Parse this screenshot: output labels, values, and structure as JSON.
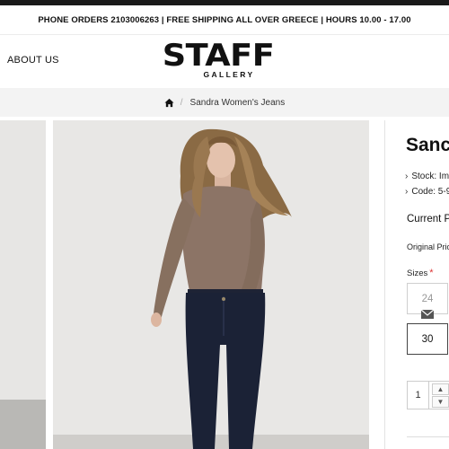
{
  "announcement": "PHONE ORDERS 2103006263 | FREE SHIPPING ALL OVER GREECE | HOURS 10.00 - 17.00",
  "header": {
    "about": "ABOUT US",
    "logo_main": "STAFF",
    "logo_sub": "GALLERY"
  },
  "breadcrumb": {
    "separator": "/",
    "current": "Sandra Women's Jeans"
  },
  "product": {
    "title": "Sanc",
    "stock": "Stock: Im",
    "code": "Code: 5-9",
    "current_price": "Current Pr",
    "original_price": "Original Pric",
    "sizes_label": "Sizes",
    "required_mark": "*",
    "sizes": [
      "24",
      "30"
    ],
    "quantity": "1"
  },
  "icons": {
    "home": "home-icon",
    "mail": "mail-icon",
    "chevron": "chevron-right-icon"
  },
  "colors": {
    "accent_required": "#d33333",
    "jeans": "#1b2236",
    "sweater": "#8c7466"
  }
}
